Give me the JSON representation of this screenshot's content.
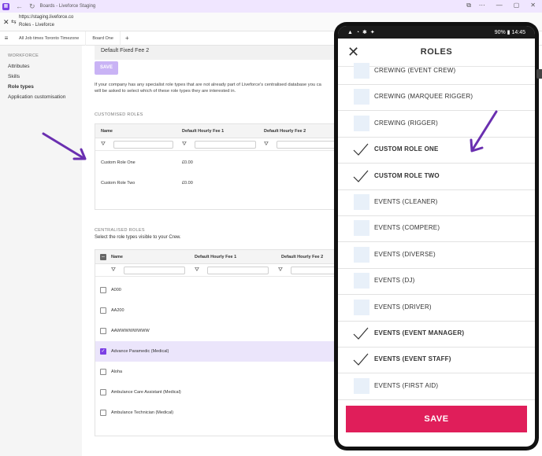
{
  "browser": {
    "title": "Boards - Liveforce Staging",
    "url": "https://staging.liveforce.co",
    "page_title": "Roles - Liveforce",
    "tabs": [
      {
        "label": "All Job times Toronto Timezone"
      },
      {
        "label": "Board One"
      }
    ],
    "new_tab": "+"
  },
  "sidebar": {
    "section": "WORKFORCE",
    "items": [
      {
        "label": "Attributes",
        "active": false
      },
      {
        "label": "Skills",
        "active": false
      },
      {
        "label": "Role types",
        "active": true
      },
      {
        "label": "Application customisation",
        "active": false
      }
    ]
  },
  "main": {
    "fee_field_value": "Default Fixed Fee 2",
    "save_label": "SAVE",
    "description_line1": "If your company has any specialist role types that are not already part of Liveforce's centralised database you ca",
    "description_line2": "will be asked to select which of these role types they are interested in.",
    "customised": {
      "title": "CUSTOMISED ROLES",
      "columns": [
        "Name",
        "Default Hourly Fee 1",
        "Default Hourly Fee 2"
      ],
      "rows": [
        {
          "name": "Custom Role One",
          "fee1": "£0.00"
        },
        {
          "name": "Custom Role Two",
          "fee1": "£0.00"
        }
      ]
    },
    "centralised": {
      "title": "CENTRALISED ROLES",
      "subtitle": "Select the role types visible to your Crew.",
      "columns": [
        "Name",
        "Default Hourly Fee 1",
        "Default Hourly Fee 2"
      ],
      "rows": [
        {
          "name": "A000",
          "checked": false
        },
        {
          "name": "AA200",
          "checked": false
        },
        {
          "name": "AAWWWWWWWW",
          "checked": false
        },
        {
          "name": "Advance Paramedic (Medical)",
          "checked": true
        },
        {
          "name": "Aloha",
          "checked": false
        },
        {
          "name": "Ambulance Care Assistant (Medical)",
          "checked": false
        },
        {
          "name": "Ambulance Technician (Medical)",
          "checked": false
        }
      ]
    }
  },
  "phone": {
    "status_right": "90% ▮ 14:45",
    "title": "ROLES",
    "save_label": "SAVE",
    "items": [
      {
        "label": "CREWING (EVENT CREW)",
        "checked": false
      },
      {
        "label": "CREWING (MARQUEE RIGGER)",
        "checked": false
      },
      {
        "label": "CREWING (RIGGER)",
        "checked": false
      },
      {
        "label": "CUSTOM ROLE ONE",
        "checked": true
      },
      {
        "label": "CUSTOM ROLE TWO",
        "checked": true
      },
      {
        "label": "EVENTS (CLEANER)",
        "checked": false
      },
      {
        "label": "EVENTS (COMPERE)",
        "checked": false
      },
      {
        "label": "EVENTS (DIVERSE)",
        "checked": false
      },
      {
        "label": "EVENTS (DJ)",
        "checked": false
      },
      {
        "label": "EVENTS (DRIVER)",
        "checked": false
      },
      {
        "label": "EVENTS (EVENT MANAGER)",
        "checked": true
      },
      {
        "label": "EVENTS (EVENT STAFF)",
        "checked": true
      },
      {
        "label": "EVENTS (FIRST AID)",
        "checked": false
      }
    ]
  },
  "colors": {
    "accent": "#7b3fe4",
    "save_phone": "#e01e5a",
    "arrow": "#6a2fb0"
  }
}
